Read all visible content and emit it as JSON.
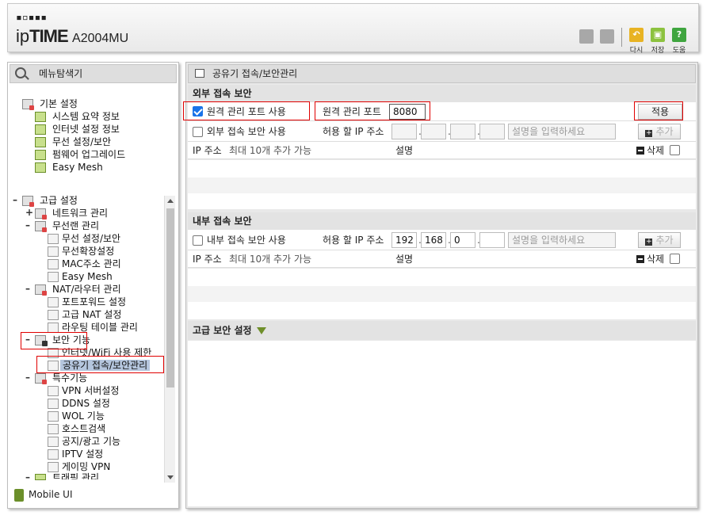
{
  "header": {
    "logo_dots": "▪▫▪▪▪",
    "logo_ip": "ip",
    "logo_time": "TIME",
    "model": "A2004MU",
    "tools": {
      "back": "다시",
      "save": "저장",
      "help": "도움"
    }
  },
  "sidebar": {
    "title": "메뉴탐색기",
    "items": [
      {
        "label": "기본 설정"
      },
      {
        "label": "시스템 요약 정보"
      },
      {
        "label": "인터넷 설정 정보"
      },
      {
        "label": "무선 설정/보안"
      },
      {
        "label": "펌웨어 업그레이드"
      },
      {
        "label": "Easy Mesh"
      },
      {
        "label": "고급 설정"
      },
      {
        "label": "네트워크 관리"
      },
      {
        "label": "무선랜 관리"
      },
      {
        "label": "무선 설정/보안"
      },
      {
        "label": "무선확장설정"
      },
      {
        "label": "MAC주소 관리"
      },
      {
        "label": "Easy Mesh"
      },
      {
        "label": "NAT/라우터 관리"
      },
      {
        "label": "포트포워드 설정"
      },
      {
        "label": "고급 NAT 설정"
      },
      {
        "label": "라우팅 테이블 관리"
      },
      {
        "label": "보안 기능"
      },
      {
        "label": "인터넷/WiFi 사용 제한"
      },
      {
        "label": "공유기 접속/보안관리"
      },
      {
        "label": "특수기능"
      },
      {
        "label": "VPN 서버설정"
      },
      {
        "label": "DDNS 설정"
      },
      {
        "label": "WOL 기능"
      },
      {
        "label": "호스트검색"
      },
      {
        "label": "공지/광고 기능"
      },
      {
        "label": "IPTV 설정"
      },
      {
        "label": "게이밍 VPN"
      },
      {
        "label": "트래픽 관리"
      }
    ],
    "mobile": "Mobile UI"
  },
  "main": {
    "title": "공유기 접속/보안관리",
    "external": {
      "title": "외부 접속 보안",
      "remote_label": "원격 관리 포트 사용",
      "remote_checked": true,
      "port_label": "원격 관리 포트",
      "port_value": "8080",
      "apply": "적용",
      "secure_label": "외부 접속 보안 사용",
      "allow_ip_label": "허용 할 IP 주소",
      "desc_placeholder": "설명을 입력하세요",
      "add": "추가",
      "col_ip": "IP 주소",
      "col_ip_hint": "최대 10개 추가 가능",
      "col_desc": "설명",
      "col_delete": "삭제"
    },
    "internal": {
      "title": "내부 접속 보안",
      "secure_label": "내부 접속 보안 사용",
      "allow_ip_label": "허용 할 IP 주소",
      "ip1": "192",
      "ip2": "168",
      "ip3": "0",
      "desc_placeholder": "설명을 입력하세요",
      "add": "추가",
      "col_ip": "IP 주소",
      "col_ip_hint": "최대 10개 추가 가능",
      "col_desc": "설명",
      "col_delete": "삭제"
    },
    "advanced": {
      "title": "고급 보안 설정"
    }
  },
  "colors": {
    "highlight": "#e00000",
    "selected": "#b5c6de",
    "checkbox": "#1a73e8"
  }
}
